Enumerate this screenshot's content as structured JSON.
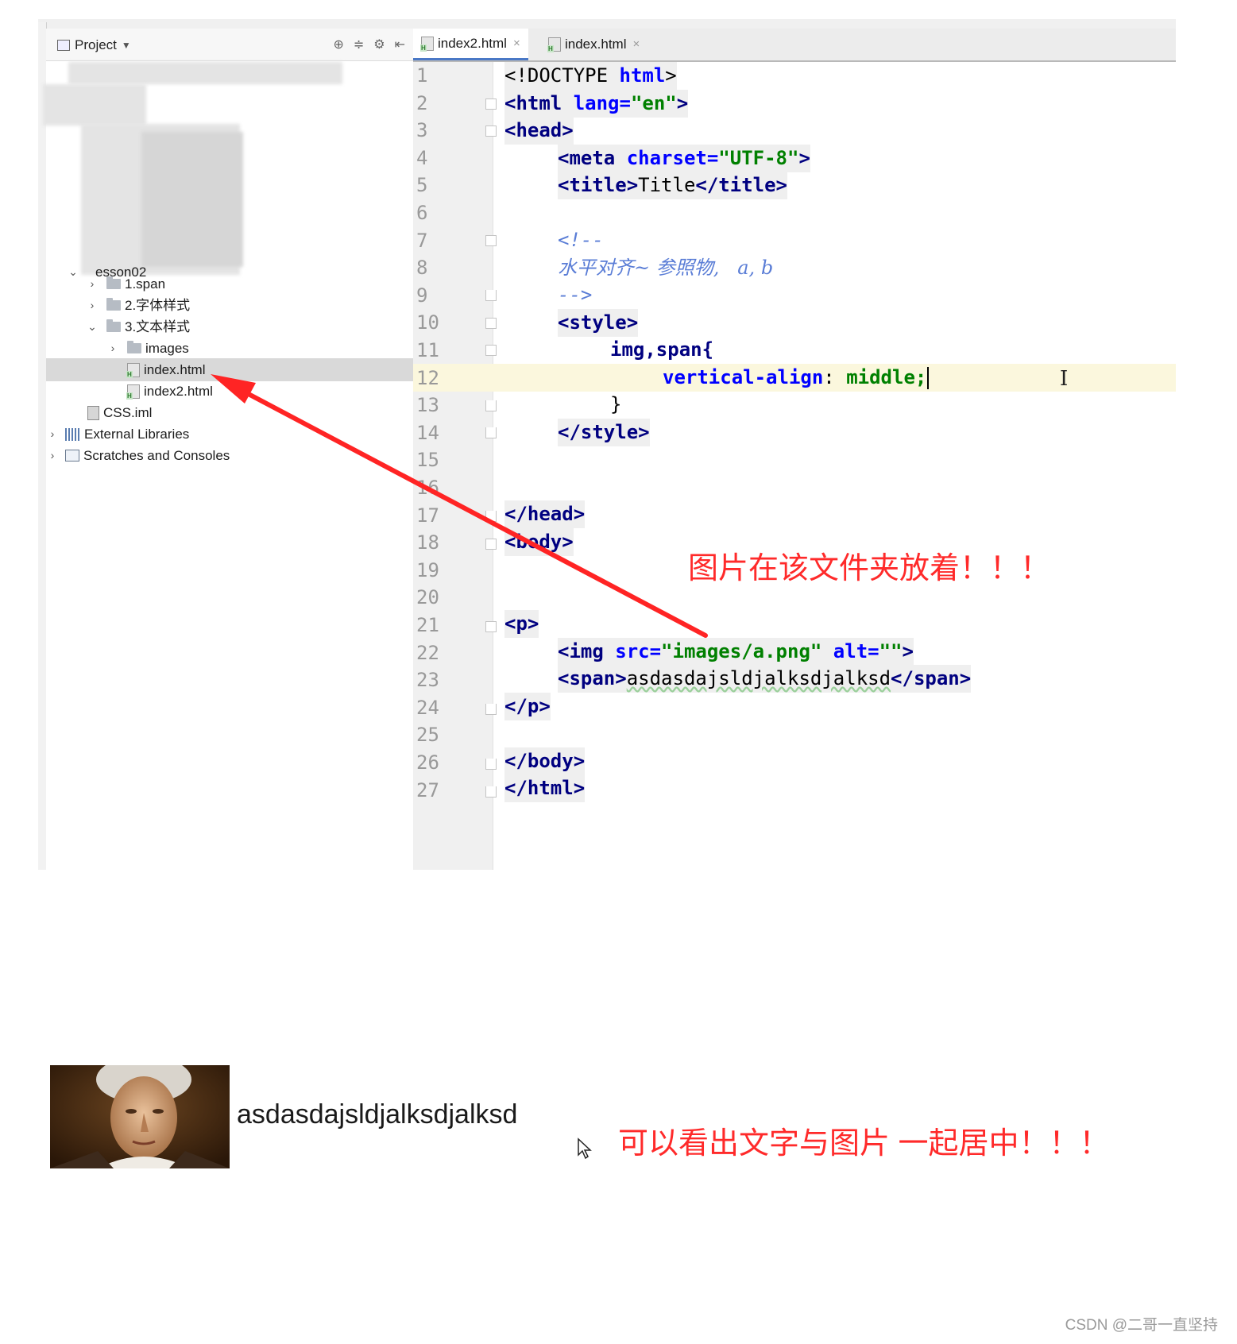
{
  "project_panel": {
    "title": "Project",
    "tree": [
      {
        "label": "esson02",
        "level": 1,
        "expanded": true
      },
      {
        "label": "1.span",
        "level": 2,
        "expanded": false
      },
      {
        "label": "2.字体样式",
        "level": 2,
        "expanded": false
      },
      {
        "label": "3.文本样式",
        "level": 2,
        "expanded": true
      },
      {
        "label": "images",
        "level": 3,
        "expanded": false
      },
      {
        "label": "index.html",
        "level": 3,
        "selected": true
      },
      {
        "label": "index2.html",
        "level": 3
      },
      {
        "label": "CSS.iml",
        "level": 1
      },
      {
        "label": "External Libraries",
        "level": 0
      },
      {
        "label": "Scratches and Consoles",
        "level": 0
      }
    ]
  },
  "tabs": [
    {
      "label": "index2.html",
      "active": true
    },
    {
      "label": "index.html",
      "active": false
    }
  ],
  "editor": {
    "line_numbers": [
      "1",
      "2",
      "3",
      "4",
      "5",
      "6",
      "7",
      "8",
      "9",
      "10",
      "11",
      "12",
      "13",
      "14",
      "15",
      "16",
      "17",
      "18",
      "19",
      "20",
      "21",
      "22",
      "23",
      "24",
      "25",
      "26",
      "27"
    ],
    "current_line": 12
  },
  "code": {
    "l1_doctype": "<!DOCTYPE ",
    "l1_html": "html",
    "l1_end": ">",
    "l2_open": "<",
    "l2_tag": "html",
    "l2_attr": " lang=",
    "l2_val": "\"en\"",
    "l2_end": ">",
    "l3_tag": "<head>",
    "l4_tag": "<meta",
    "l4_attr": " charset=",
    "l4_val": "\"UTF-8\"",
    "l4_end": ">",
    "l5_open": "<title>",
    "l5_text": "Title",
    "l5_close": "</title>",
    "l7": "<!--",
    "l8": "水平对齐~ 参照物,   a, b",
    "l9": "-->",
    "l10": "<style>",
    "l11": "img,span{",
    "l12_prop": "vertical-align",
    "l12_colon": ": ",
    "l12_val": "middle;",
    "l13": "}",
    "l14": "</style>",
    "l17": "</head>",
    "l18": "<body>",
    "l21": "<p>",
    "l22_tag": "<img",
    "l22_attr1": " src=",
    "l22_val1": "\"images/a.png\"",
    "l22_attr2": " alt=",
    "l22_val2": "\"\"",
    "l22_end": ">",
    "l23_open": "<span>",
    "l23_text": "asdasdajsldjalksdjalksd",
    "l23_close": "</span>",
    "l24": "</p>",
    "l26": "</body>",
    "l27": "</html>"
  },
  "annotations": {
    "folder_note": "图片在该文件夹放着！！！",
    "result_note": "可以看出文字与图片 一起居中！！！"
  },
  "preview": {
    "span_text": "asdasdajsldjalksdjalksd"
  },
  "watermark": "CSDN @二哥一直坚持",
  "colors": {
    "tag": "#000080",
    "attribute": "#0000ff",
    "string": "#008000",
    "comment": "#5a7dd6",
    "annotation": "#ff2a2a",
    "current_line": "#fbf7dd"
  }
}
